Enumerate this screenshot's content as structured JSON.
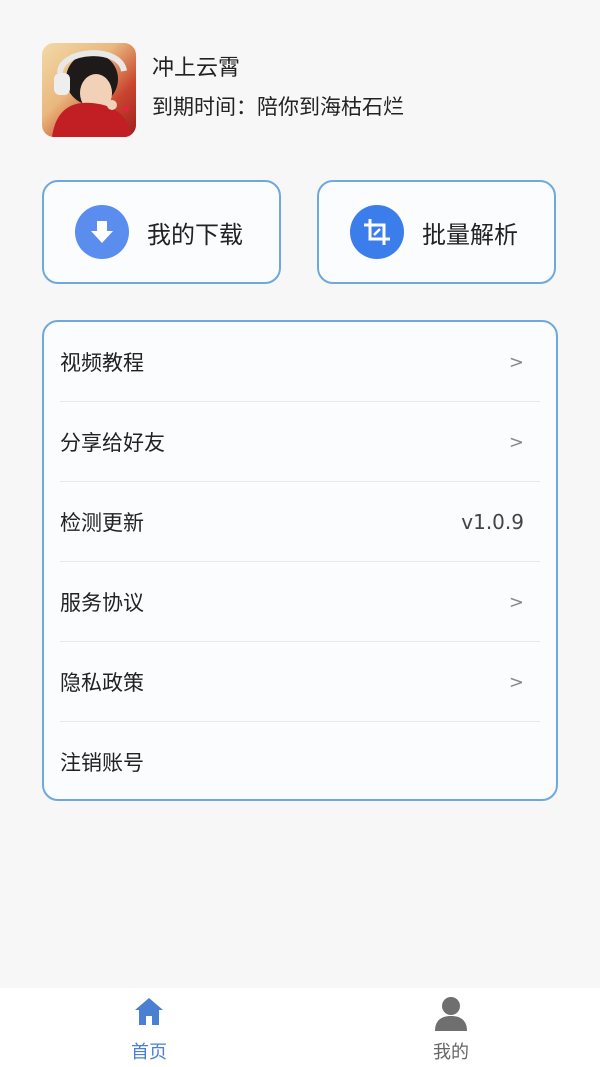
{
  "profile": {
    "username": "冲上云霄",
    "expire_text": "到期时间：陪你到海枯石烂"
  },
  "quick_actions": [
    {
      "label": "我的下载",
      "icon": "download-icon"
    },
    {
      "label": "批量解析",
      "icon": "crop-icon"
    }
  ],
  "menu": {
    "items": [
      {
        "label": "视频教程",
        "trailing": ">"
      },
      {
        "label": "分享给好友",
        "trailing": ">"
      },
      {
        "label": "检测更新",
        "value": "v1.0.9"
      },
      {
        "label": "服务协议",
        "trailing": ">"
      },
      {
        "label": "隐私政策",
        "trailing": ">"
      },
      {
        "label": "注销账号"
      }
    ]
  },
  "tabbar": {
    "home_label": "首页",
    "me_label": "我的"
  },
  "colors": {
    "accent": "#4a7fd1",
    "card_border": "#6fa8dc",
    "download_icon_bg": "#5b8def",
    "batch_icon_bg": "#3b7dea"
  }
}
